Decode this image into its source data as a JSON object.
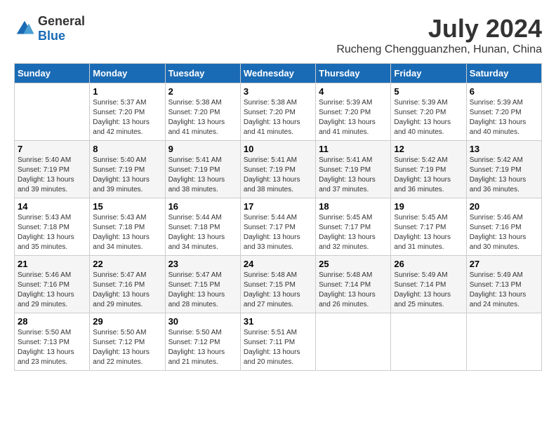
{
  "header": {
    "logo_general": "General",
    "logo_blue": "Blue",
    "month": "July 2024",
    "location": "Rucheng Chengguanzhen, Hunan, China"
  },
  "days_of_week": [
    "Sunday",
    "Monday",
    "Tuesday",
    "Wednesday",
    "Thursday",
    "Friday",
    "Saturday"
  ],
  "weeks": [
    [
      {
        "day": "",
        "info": ""
      },
      {
        "day": "1",
        "info": "Sunrise: 5:37 AM\nSunset: 7:20 PM\nDaylight: 13 hours\nand 42 minutes."
      },
      {
        "day": "2",
        "info": "Sunrise: 5:38 AM\nSunset: 7:20 PM\nDaylight: 13 hours\nand 41 minutes."
      },
      {
        "day": "3",
        "info": "Sunrise: 5:38 AM\nSunset: 7:20 PM\nDaylight: 13 hours\nand 41 minutes."
      },
      {
        "day": "4",
        "info": "Sunrise: 5:39 AM\nSunset: 7:20 PM\nDaylight: 13 hours\nand 41 minutes."
      },
      {
        "day": "5",
        "info": "Sunrise: 5:39 AM\nSunset: 7:20 PM\nDaylight: 13 hours\nand 40 minutes."
      },
      {
        "day": "6",
        "info": "Sunrise: 5:39 AM\nSunset: 7:20 PM\nDaylight: 13 hours\nand 40 minutes."
      }
    ],
    [
      {
        "day": "7",
        "info": "Sunrise: 5:40 AM\nSunset: 7:19 PM\nDaylight: 13 hours\nand 39 minutes."
      },
      {
        "day": "8",
        "info": "Sunrise: 5:40 AM\nSunset: 7:19 PM\nDaylight: 13 hours\nand 39 minutes."
      },
      {
        "day": "9",
        "info": "Sunrise: 5:41 AM\nSunset: 7:19 PM\nDaylight: 13 hours\nand 38 minutes."
      },
      {
        "day": "10",
        "info": "Sunrise: 5:41 AM\nSunset: 7:19 PM\nDaylight: 13 hours\nand 38 minutes."
      },
      {
        "day": "11",
        "info": "Sunrise: 5:41 AM\nSunset: 7:19 PM\nDaylight: 13 hours\nand 37 minutes."
      },
      {
        "day": "12",
        "info": "Sunrise: 5:42 AM\nSunset: 7:19 PM\nDaylight: 13 hours\nand 36 minutes."
      },
      {
        "day": "13",
        "info": "Sunrise: 5:42 AM\nSunset: 7:19 PM\nDaylight: 13 hours\nand 36 minutes."
      }
    ],
    [
      {
        "day": "14",
        "info": "Sunrise: 5:43 AM\nSunset: 7:18 PM\nDaylight: 13 hours\nand 35 minutes."
      },
      {
        "day": "15",
        "info": "Sunrise: 5:43 AM\nSunset: 7:18 PM\nDaylight: 13 hours\nand 34 minutes."
      },
      {
        "day": "16",
        "info": "Sunrise: 5:44 AM\nSunset: 7:18 PM\nDaylight: 13 hours\nand 34 minutes."
      },
      {
        "day": "17",
        "info": "Sunrise: 5:44 AM\nSunset: 7:17 PM\nDaylight: 13 hours\nand 33 minutes."
      },
      {
        "day": "18",
        "info": "Sunrise: 5:45 AM\nSunset: 7:17 PM\nDaylight: 13 hours\nand 32 minutes."
      },
      {
        "day": "19",
        "info": "Sunrise: 5:45 AM\nSunset: 7:17 PM\nDaylight: 13 hours\nand 31 minutes."
      },
      {
        "day": "20",
        "info": "Sunrise: 5:46 AM\nSunset: 7:16 PM\nDaylight: 13 hours\nand 30 minutes."
      }
    ],
    [
      {
        "day": "21",
        "info": "Sunrise: 5:46 AM\nSunset: 7:16 PM\nDaylight: 13 hours\nand 29 minutes."
      },
      {
        "day": "22",
        "info": "Sunrise: 5:47 AM\nSunset: 7:16 PM\nDaylight: 13 hours\nand 29 minutes."
      },
      {
        "day": "23",
        "info": "Sunrise: 5:47 AM\nSunset: 7:15 PM\nDaylight: 13 hours\nand 28 minutes."
      },
      {
        "day": "24",
        "info": "Sunrise: 5:48 AM\nSunset: 7:15 PM\nDaylight: 13 hours\nand 27 minutes."
      },
      {
        "day": "25",
        "info": "Sunrise: 5:48 AM\nSunset: 7:14 PM\nDaylight: 13 hours\nand 26 minutes."
      },
      {
        "day": "26",
        "info": "Sunrise: 5:49 AM\nSunset: 7:14 PM\nDaylight: 13 hours\nand 25 minutes."
      },
      {
        "day": "27",
        "info": "Sunrise: 5:49 AM\nSunset: 7:13 PM\nDaylight: 13 hours\nand 24 minutes."
      }
    ],
    [
      {
        "day": "28",
        "info": "Sunrise: 5:50 AM\nSunset: 7:13 PM\nDaylight: 13 hours\nand 23 minutes."
      },
      {
        "day": "29",
        "info": "Sunrise: 5:50 AM\nSunset: 7:12 PM\nDaylight: 13 hours\nand 22 minutes."
      },
      {
        "day": "30",
        "info": "Sunrise: 5:50 AM\nSunset: 7:12 PM\nDaylight: 13 hours\nand 21 minutes."
      },
      {
        "day": "31",
        "info": "Sunrise: 5:51 AM\nSunset: 7:11 PM\nDaylight: 13 hours\nand 20 minutes."
      },
      {
        "day": "",
        "info": ""
      },
      {
        "day": "",
        "info": ""
      },
      {
        "day": "",
        "info": ""
      }
    ]
  ]
}
